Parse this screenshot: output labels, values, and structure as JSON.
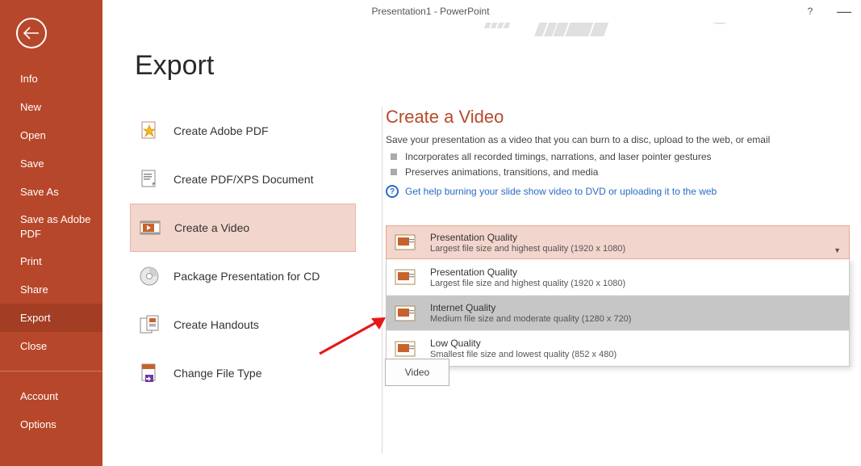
{
  "title": "Presentation1 - PowerPoint",
  "sidebar": {
    "items": [
      {
        "label": "Info"
      },
      {
        "label": "New"
      },
      {
        "label": "Open"
      },
      {
        "label": "Save"
      },
      {
        "label": "Save As"
      },
      {
        "label": "Save as Adobe PDF"
      },
      {
        "label": "Print"
      },
      {
        "label": "Share"
      },
      {
        "label": "Export"
      },
      {
        "label": "Close"
      }
    ],
    "bottom": [
      {
        "label": "Account"
      },
      {
        "label": "Options"
      }
    ]
  },
  "page": {
    "title": "Export"
  },
  "export_options": [
    {
      "label": "Create Adobe PDF"
    },
    {
      "label": "Create PDF/XPS Document"
    },
    {
      "label": "Create a Video"
    },
    {
      "label": "Package Presentation for CD"
    },
    {
      "label": "Create Handouts"
    },
    {
      "label": "Change File Type"
    }
  ],
  "detail": {
    "title": "Create a Video",
    "description": "Save your presentation as a video that you can burn to a disc, upload to the web, or email",
    "bullets": [
      "Incorporates all recorded timings, narrations, and laser pointer gestures",
      "Preserves animations, transitions, and media"
    ],
    "help_link": "Get help burning your slide show video to DVD or uploading it to the web",
    "selected_quality": {
      "label": "Presentation Quality",
      "sub": "Largest file size and highest quality (1920 x 1080)"
    },
    "quality_options": [
      {
        "label": "Presentation Quality",
        "sub": "Largest file size and highest quality (1920 x 1080)"
      },
      {
        "label": "Internet Quality",
        "sub": "Medium file size and moderate quality (1280 x 720)"
      },
      {
        "label": "Low Quality",
        "sub": "Smallest file size and lowest quality (852 x 480)"
      }
    ],
    "video_button": "Video"
  }
}
